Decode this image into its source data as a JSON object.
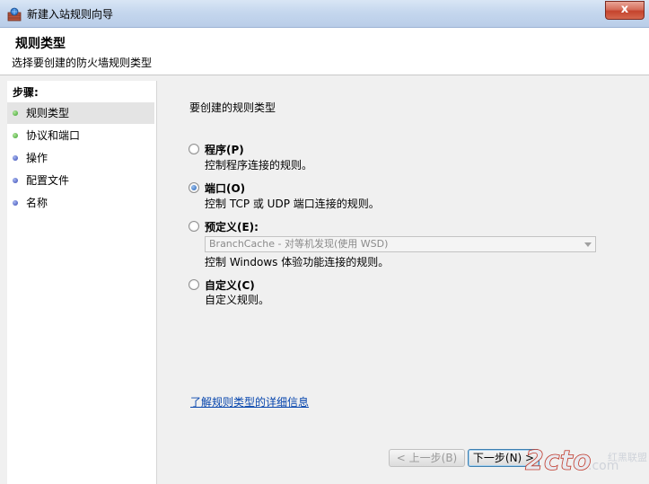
{
  "window": {
    "title": "新建入站规则向导",
    "close_label": "x"
  },
  "header": {
    "title": "规则类型",
    "subtitle": "选择要创建的防火墙规则类型"
  },
  "sidebar": {
    "title": "步骤:",
    "items": [
      {
        "label": "规则类型",
        "state": "done"
      },
      {
        "label": "协议和端口",
        "state": "done"
      },
      {
        "label": "操作",
        "state": "pending"
      },
      {
        "label": "配置文件",
        "state": "pending"
      },
      {
        "label": "名称",
        "state": "pending"
      }
    ]
  },
  "main": {
    "question": "要创建的规则类型",
    "options": [
      {
        "title": "程序(P)",
        "desc": "控制程序连接的规则。",
        "checked": false
      },
      {
        "title": "端口(O)",
        "desc": "控制 TCP 或 UDP 端口连接的规则。",
        "checked": true
      },
      {
        "title": "预定义(E):",
        "desc": "控制 Windows 体验功能连接的规则。",
        "checked": false
      },
      {
        "title": "自定义(C)",
        "desc": "自定义规则。",
        "checked": false
      }
    ],
    "predefined_select_value": "BranchCache - 对等机发现(使用 WSD)",
    "learn_more": "了解规则类型的详细信息"
  },
  "buttons": {
    "back": "< 上一步(B)",
    "next": "下一步(N) >"
  },
  "watermark": {
    "logo": "2cto",
    "suffix": ".com",
    "brand": "红黑联盟"
  },
  "colors": {
    "active_step": "#3a9f2a",
    "pending_step": "#3648b2",
    "link": "#0645ad"
  }
}
